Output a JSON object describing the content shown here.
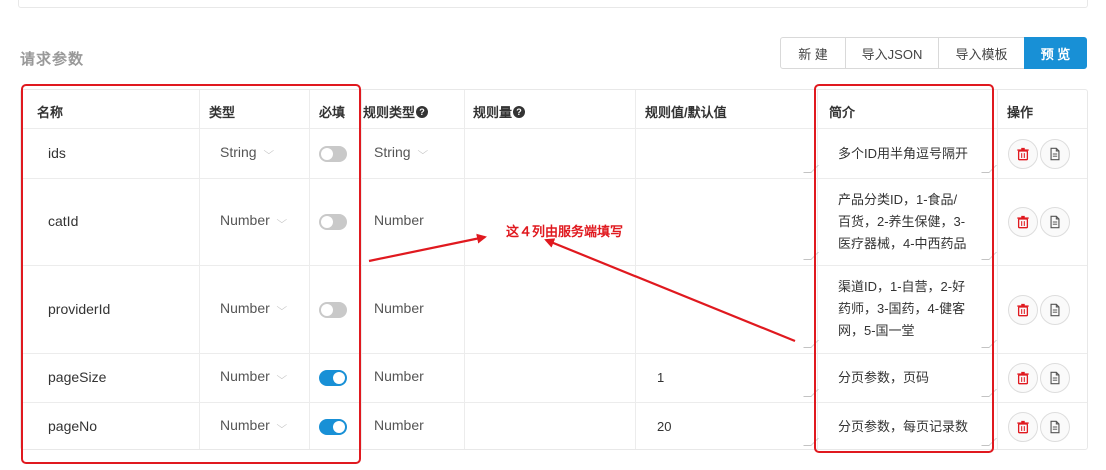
{
  "section": {
    "title": "请求参数"
  },
  "toolbar": {
    "new_label": "新 建",
    "import_json_label": "导入JSON",
    "import_template_label": "导入模板",
    "preview_label": "预 览"
  },
  "table": {
    "headers": {
      "name": "名称",
      "type": "类型",
      "required": "必填",
      "rule_type": "规则类型",
      "rule_amount": "规则量",
      "rule_value": "规则值/默认值",
      "desc": "简介",
      "actions": "操作"
    },
    "rows": [
      {
        "name": "ids",
        "type": "String",
        "required": false,
        "rule_type": "String",
        "rule_value": "",
        "desc": "多个ID用半角逗号隔开"
      },
      {
        "name": "catId",
        "type": "Number",
        "required": false,
        "rule_type": "Number",
        "rule_value": "",
        "desc": "产品分类ID，1-食品/\n百货，2-养生保健，3-\n医疗器械，4-中西药品"
      },
      {
        "name": "providerId",
        "type": "Number",
        "required": false,
        "rule_type": "Number",
        "rule_value": "",
        "desc": "渠道ID，1-自营，2-好\n药师，3-国药，4-健客\n网，5-国一堂"
      },
      {
        "name": "pageSize",
        "type": "Number",
        "required": true,
        "rule_type": "Number",
        "rule_value": "1",
        "desc": "分页参数，页码"
      },
      {
        "name": "pageNo",
        "type": "Number",
        "required": true,
        "rule_type": "Number",
        "rule_value": "20",
        "desc": "分页参数，每页记录数"
      }
    ]
  },
  "annotation": {
    "text": "这４列由服务端填写"
  },
  "colors": {
    "accent": "#1890d6",
    "annotation": "#e0191f",
    "toggle_off": "#c9c9c9",
    "delete_icon": "#e0191f"
  },
  "icons": {
    "help": "question-circle-icon",
    "delete": "trash-icon",
    "copy": "document-icon",
    "dropdown": "chevron-down-icon"
  }
}
